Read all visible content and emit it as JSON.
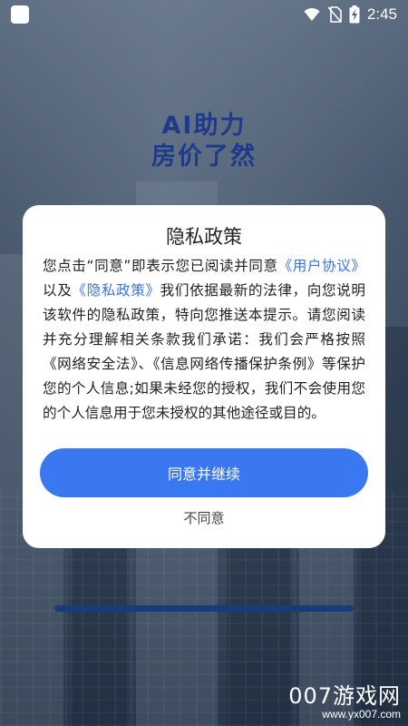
{
  "status_bar": {
    "time": "2:45",
    "icons": [
      "app-icon",
      "wifi-icon",
      "no-sim-icon",
      "battery-charging-icon"
    ]
  },
  "hero": {
    "line1": "AI助力",
    "line2": "房价了然"
  },
  "dialog": {
    "title": "隐私政策",
    "body_start": "您点击“同意”即表示您已阅读并同意",
    "user_agreement_link": "《用户协议》",
    "conjunction": "以及",
    "privacy_policy_link": "《隐私政策》",
    "body_rest": "我们依据最新的法律，向您说明该软件的隐私政策，特向您推送本提示。请您阅读并充分理解相关条款我们承诺：我们会严格按照《网络安全法》、《信息网络传播保护条例》等保护您的个人信息;如果未经您的授权，我们不会使用您的个人信息用于您未授权的其他途径或目的。",
    "agree_label": "同意并继续",
    "disagree_label": "不同意",
    "link_color": "#3a74e8",
    "button_color": "#3a78f2"
  },
  "loading": {
    "progress": 1.0
  },
  "watermark": {
    "brand": "007游戏网",
    "url": "www.yx007.com"
  }
}
